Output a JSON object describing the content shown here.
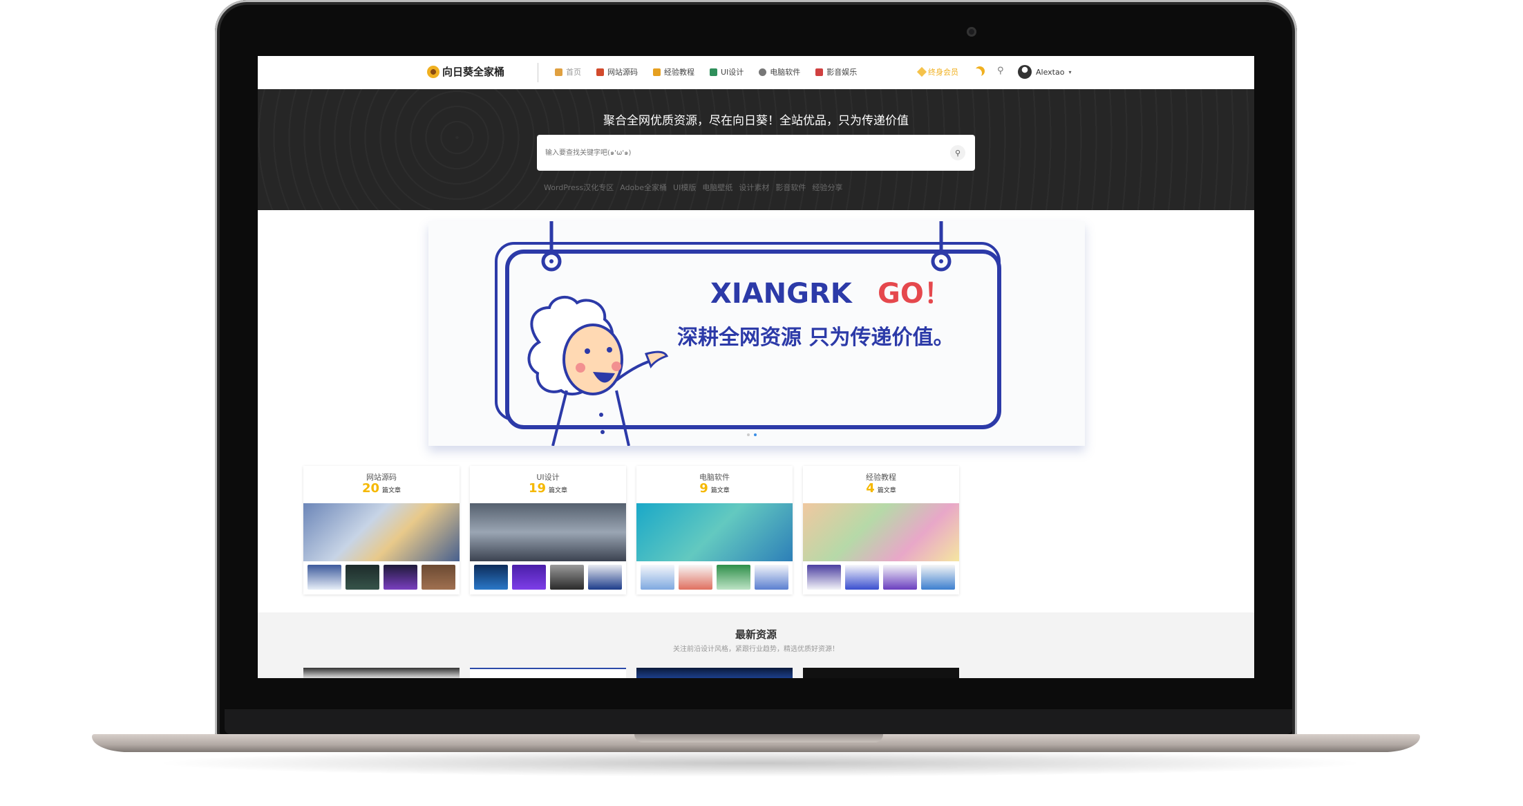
{
  "header": {
    "logo_text": "向日葵全家桶",
    "nav": [
      {
        "label": "首页",
        "icon": "home-icon",
        "color": "#e0a040"
      },
      {
        "label": "网站源码",
        "icon": "code-icon",
        "color": "#d24a2c"
      },
      {
        "label": "经验教程",
        "icon": "book-icon",
        "color": "#e6a020"
      },
      {
        "label": "UI设计",
        "icon": "palette-icon",
        "color": "#2f8f5b"
      },
      {
        "label": "电脑软件",
        "icon": "gear-icon",
        "color": "#777777"
      },
      {
        "label": "影音娱乐",
        "icon": "car-icon",
        "color": "#d04040"
      }
    ],
    "vip_label": "终身会员",
    "username": "Alextao"
  },
  "hero": {
    "title": "聚合全网优质资源，尽在向日葵！全站优品，只为传递价值",
    "search_placeholder": "输入要查找关键字吧(๑'ω'๑)",
    "hot_tags": [
      "WordPress汉化专区",
      "Adobe全家桶",
      "UI模版",
      "电脑壁纸",
      "设计素材",
      "影音软件",
      "经验分享"
    ]
  },
  "banner": {
    "headline_a": "XIANGRK",
    "headline_b": "GO！",
    "tagline": "深耕全网资源  只为传递价值。",
    "colors": {
      "blue": "#2c3aa8",
      "red": "#e5484d"
    }
  },
  "categories": [
    {
      "name": "网站源码",
      "count": "20",
      "unit": "篇文章"
    },
    {
      "name": "UI设计",
      "count": "19",
      "unit": "篇文章"
    },
    {
      "name": "电脑软件",
      "count": "9",
      "unit": "篇文章"
    },
    {
      "name": "经验教程",
      "count": "4",
      "unit": "篇文章"
    }
  ],
  "latest": {
    "title": "最新资源",
    "subtitle": "关注前沿设计风格，紧跟行业趋势，精选优质好资源！"
  }
}
